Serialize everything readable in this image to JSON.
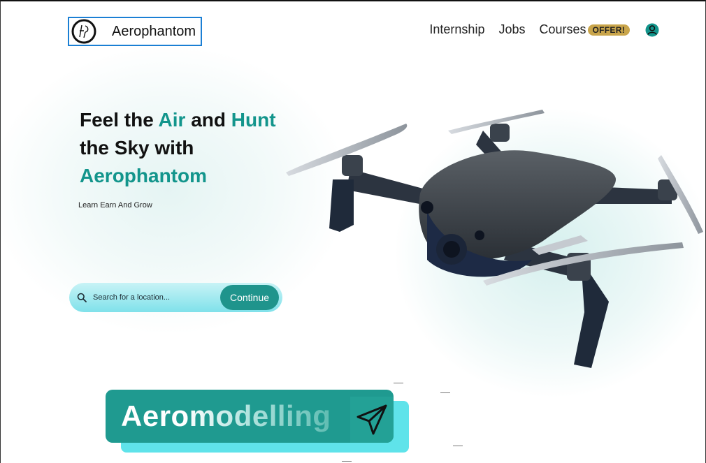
{
  "brand": {
    "name": "Aerophantom"
  },
  "nav": {
    "links": [
      "Internship",
      "Jobs",
      "Courses"
    ],
    "offer_badge": "OFFER!"
  },
  "hero": {
    "line1_a": "Feel the ",
    "line1_b": "Air",
    "line1_c": " and ",
    "line1_d": "Hunt",
    "line2": "the Sky with",
    "line3": "Aerophantom",
    "tagline": "Learn Earn And Grow"
  },
  "search": {
    "placeholder": "Search for a location...",
    "button_label": "Continue"
  },
  "banner": {
    "text": "Aeromodelling"
  },
  "icons": {
    "logo": "logo-mark-icon",
    "user": "user-icon",
    "search": "search-icon",
    "banner": "paper-plane-icon",
    "hero_image": "drone-image"
  },
  "colors": {
    "accent": "#13958c",
    "button": "#1f948c",
    "offer": "#c9a54b",
    "banner": "#1f9a90",
    "banner_back": "#5fe3ea",
    "logo_border": "#1b7fd4"
  }
}
